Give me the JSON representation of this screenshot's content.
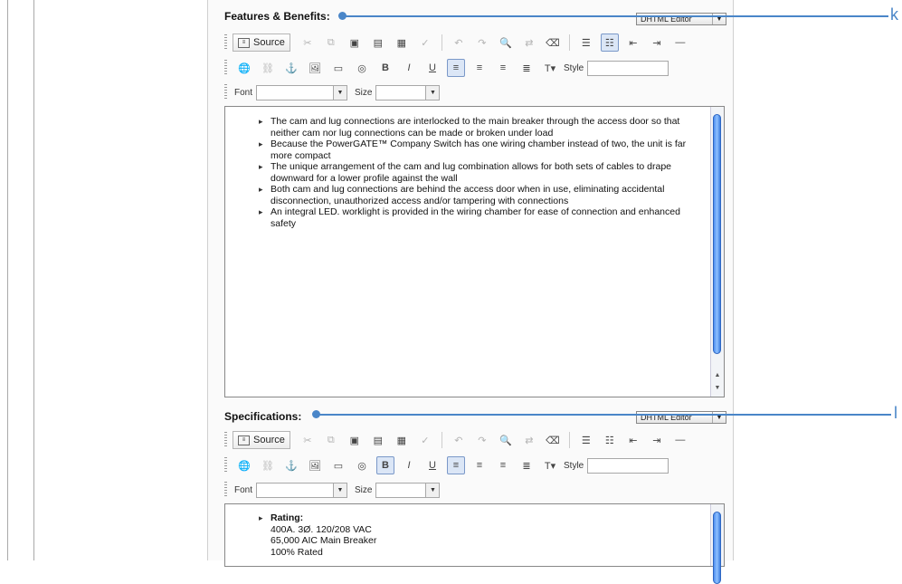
{
  "editor_mode": "DHTML Editor",
  "toolbar": {
    "source_label": "Source",
    "style_label": "Style",
    "font_label": "Font",
    "size_label": "Size"
  },
  "features": {
    "title": "Features & Benefits:",
    "bullets": [
      "The cam and lug connections are interlocked to the main breaker through the access door so that neither cam nor lug connections can be made or broken under load",
      "Because the PowerGATE™ Company Switch has one wiring chamber instead of two, the unit is far more compact",
      "The unique arrangement of the cam and lug combination allows for both sets of cables to drape downward for a lower profile against the wall",
      "Both cam and lug connections are behind the access door when in use, eliminating accidental disconnection, unauthorized access and/or tampering with connections",
      "An integral LED. worklight is provided in the wiring chamber for ease of connection and enhanced safety"
    ]
  },
  "specifications": {
    "title": "Specifications:",
    "items": [
      "Rating:",
      "400A. 3Ø. 120/208 VAC",
      "65,000 AIC Main Breaker",
      "100% Rated"
    ]
  },
  "callouts": {
    "k": "k",
    "l": "l"
  },
  "colors": {
    "callout": "#4a86c8",
    "active_button": "#dbe6f6"
  }
}
